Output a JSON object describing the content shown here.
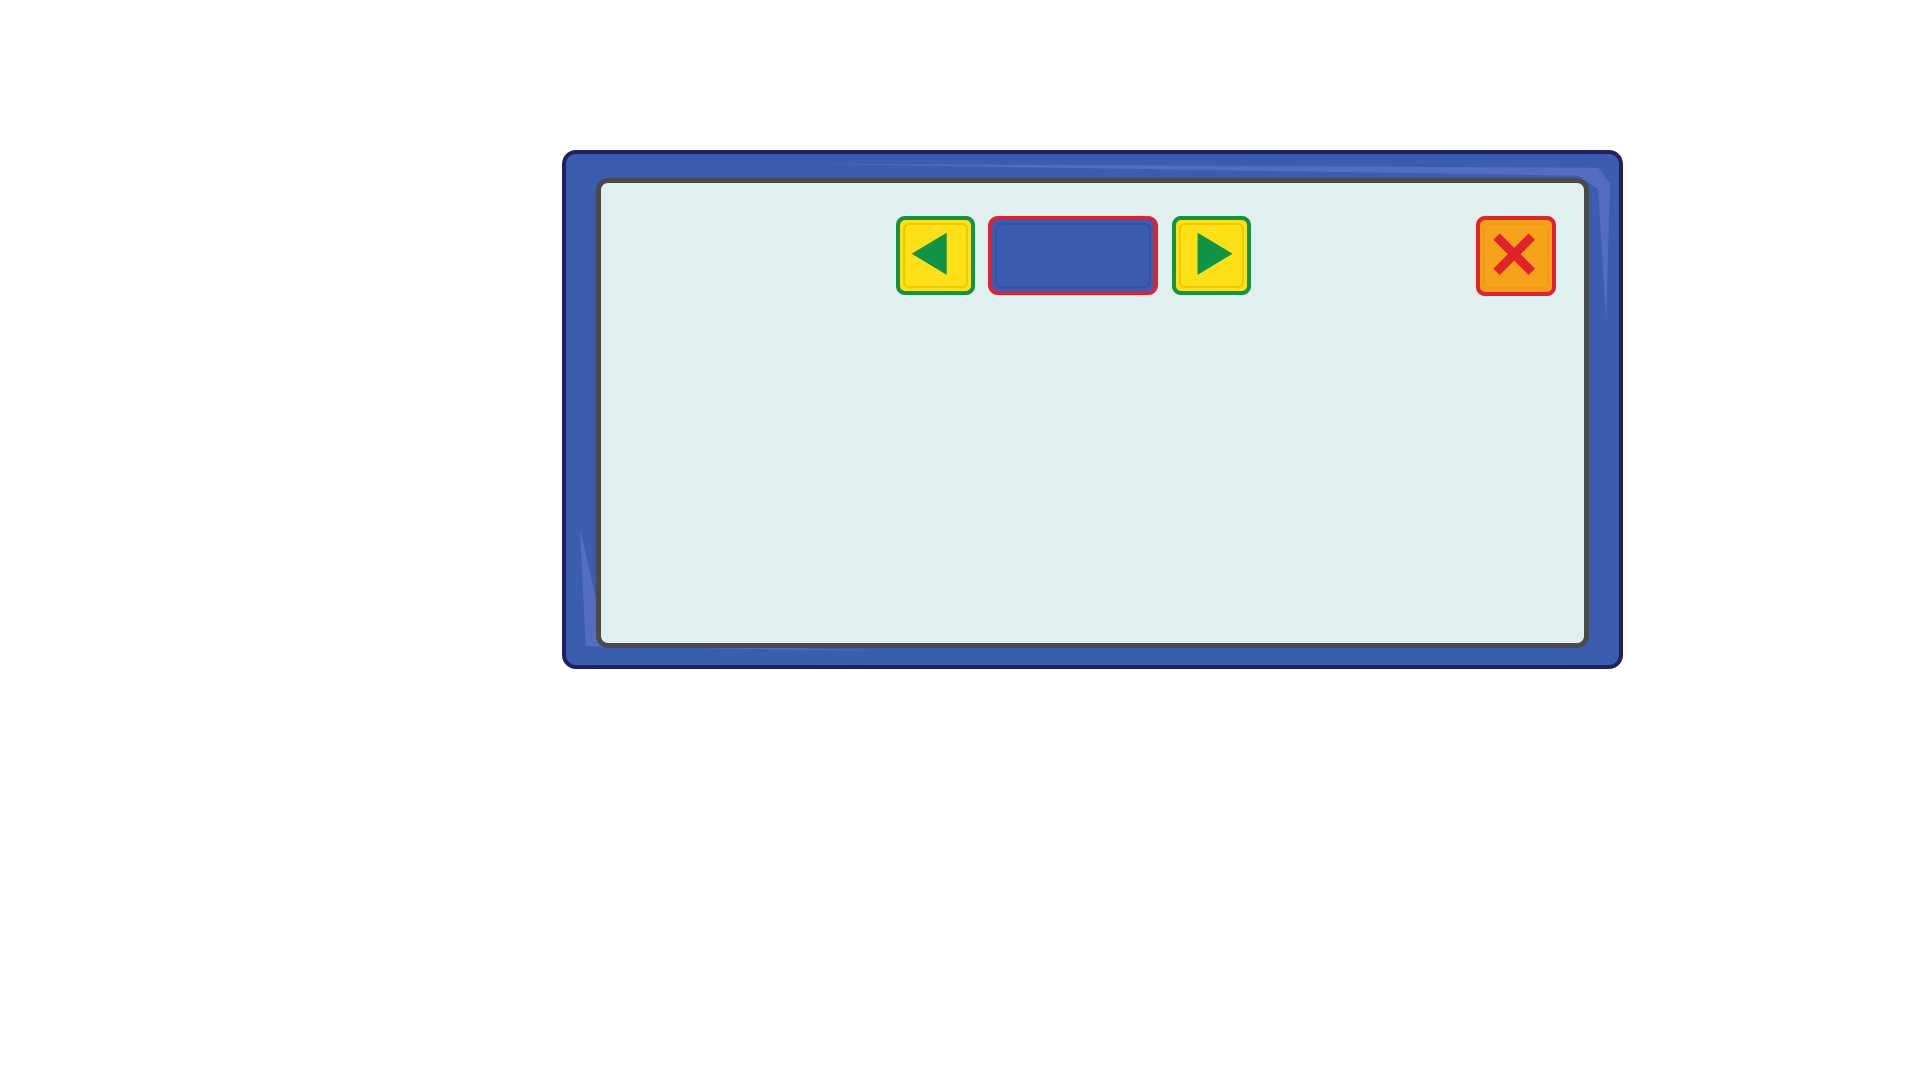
{
  "dialog": {
    "title": "",
    "content": ""
  },
  "icons": {
    "prev": "arrow-left-icon",
    "next": "arrow-right-icon",
    "close": "close-x-icon"
  },
  "colors": {
    "frame": "#3a5db0",
    "frame_border": "#23205e",
    "panel": "#e0eff0",
    "panel_border": "#4a4a4a",
    "arrow_button_fill": "#fde018",
    "arrow_button_border": "#0e9444",
    "arrow_glyph": "#0e9444",
    "title_plate_fill": "#3a5db0",
    "title_plate_border": "#e0232b",
    "close_button_fill": "#f7a21b",
    "close_button_border": "#e0232b",
    "close_glyph": "#e0232b"
  }
}
